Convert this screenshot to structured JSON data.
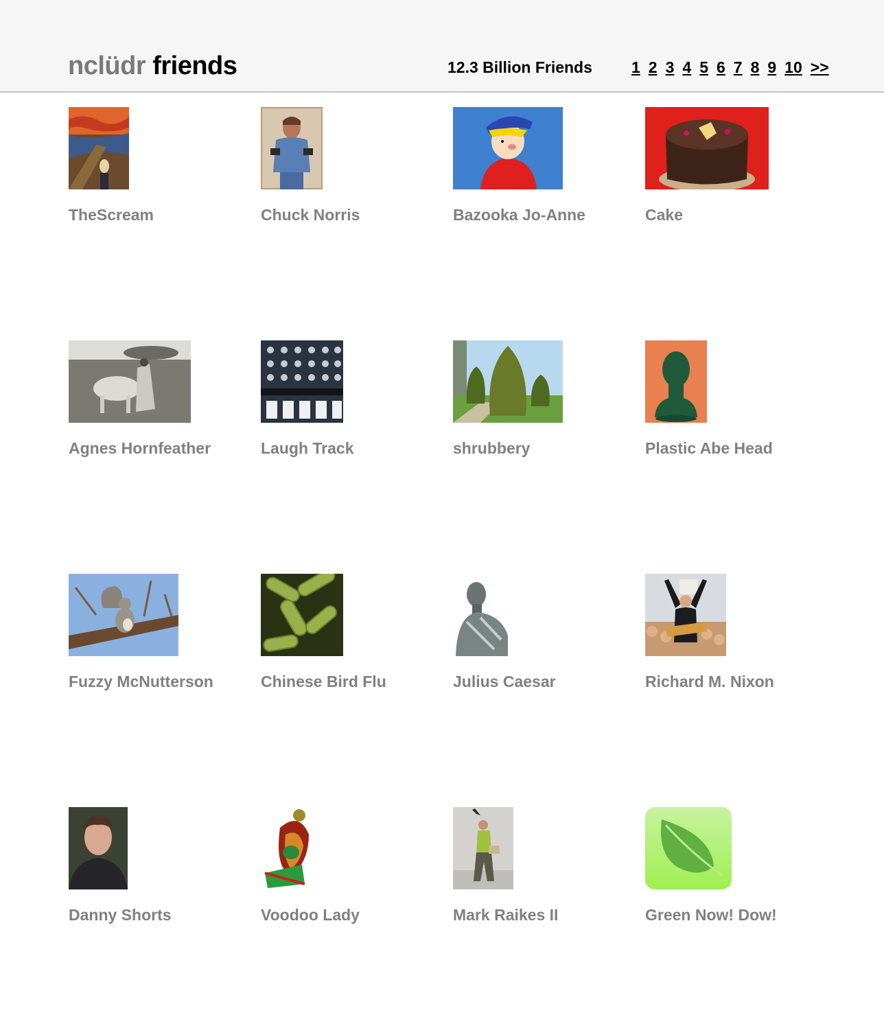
{
  "header": {
    "logo_prefix": "nclüdr",
    "logo_suffix": "friends",
    "friend_count": "12.3 Billion Friends",
    "pages": [
      "1",
      "2",
      "3",
      "4",
      "5",
      "6",
      "7",
      "8",
      "9",
      "10",
      ">>"
    ]
  },
  "friends": [
    {
      "name": "TheScream",
      "icon": "the-scream-painting"
    },
    {
      "name": "Chuck Norris",
      "icon": "chuck-norris-photo"
    },
    {
      "name": "Bazooka Jo-Anne",
      "icon": "cartoon-kid"
    },
    {
      "name": "Cake",
      "icon": "chocolate-cake"
    },
    {
      "name": "Agnes Hornfeather",
      "icon": "woman-with-cow"
    },
    {
      "name": "Laugh Track",
      "icon": "mixing-board"
    },
    {
      "name": "shrubbery",
      "icon": "topiary-shrub"
    },
    {
      "name": "Plastic Abe Head",
      "icon": "green-bust"
    },
    {
      "name": "Fuzzy McNutterson",
      "icon": "squirrel"
    },
    {
      "name": "Chinese Bird Flu",
      "icon": "bacteria"
    },
    {
      "name": "Julius Caesar",
      "icon": "caesar-statue"
    },
    {
      "name": "Richard M. Nixon",
      "icon": "nixon-rally"
    },
    {
      "name": "Danny Shorts",
      "icon": "man-portrait"
    },
    {
      "name": "Voodoo Lady",
      "icon": "voodoo-figure"
    },
    {
      "name": "Mark Raikes II",
      "icon": "man-standing"
    },
    {
      "name": "Green Now! Dow!",
      "icon": "green-leaf"
    }
  ]
}
